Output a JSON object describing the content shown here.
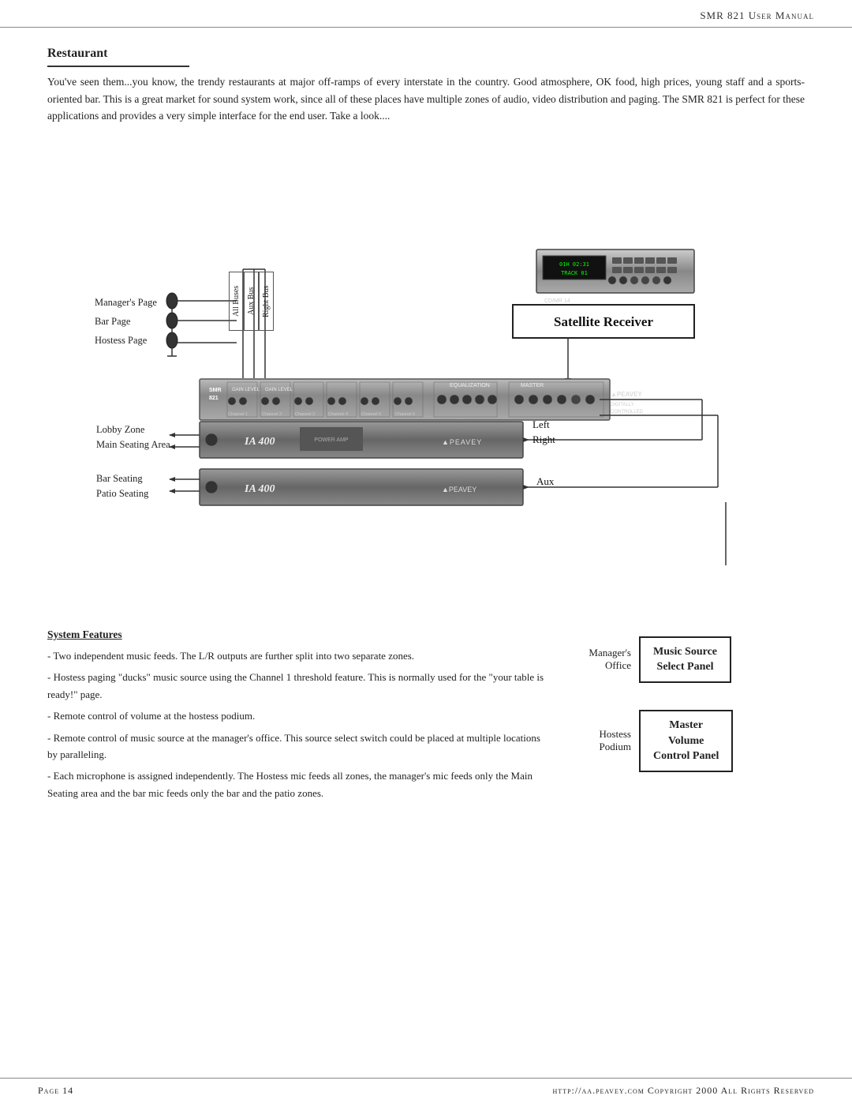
{
  "header": {
    "title": "SMR 821 User Manual"
  },
  "footer": {
    "page_label": "Page 14",
    "copyright": "http://aa.peavey.com  Copyright 2000 All Rights Reserved"
  },
  "section": {
    "heading": "Restaurant",
    "intro": "You've seen them...you know, the trendy restaurants at major off-ramps of every interstate in the country.  Good atmosphere, OK food, high prices, young staff and a sports-oriented bar.  This is a great market for sound system work, since all of these places have multiple zones of audio, video distribution and paging.  The SMR 821 is perfect for these applications and provides a very simple interface for the end user.  Take a look...."
  },
  "diagram": {
    "satellite_receiver_label": "Satellite Receiver",
    "bus_labels": [
      "All Buses",
      "Aux Bus",
      "Right Bus"
    ],
    "mic_labels": [
      "Manager's Page",
      "Bar Page",
      "Hostess Page"
    ],
    "zone_labels": [
      "Lobby Zone",
      "Main Seating Area",
      "Bar Seating",
      "Patio Seating"
    ],
    "output_labels": [
      "Left",
      "Right",
      "Aux"
    ],
    "smr_label": "SMR\n821",
    "amp_label": "IA 400",
    "amp_brand": "PEAVEY",
    "display_text1": "01H  02:31",
    "display_text2": "TRACK  01",
    "sat_device_label": "CD/MR 14"
  },
  "features": {
    "heading": "System Features",
    "items": [
      "- Two independent music feeds. The L/R outputs are further split into two separate zones.",
      "- Hostess paging \"ducks\" music source using the Channel 1 threshold feature. This is normally used for the \"your table is ready!\" page.",
      "- Remote control of volume at the hostess podium.",
      "- Remote control of music source at the manager's office. This source select switch could be placed at multiple locations by paralleling.",
      "- Each microphone is assigned independently. The Hostess mic feeds all zones, the manager's mic feeds only the Main Seating area and the bar mic feeds only the bar and the patio zones."
    ]
  },
  "panels": {
    "music_source": {
      "label1": "Music Source",
      "label2": "Select Panel",
      "side_label": "Manager's\nOffice"
    },
    "master_volume": {
      "label1": "Master",
      "label2": "Volume",
      "label3": "Control Panel",
      "side_label": "Hostess\nPodium"
    }
  }
}
